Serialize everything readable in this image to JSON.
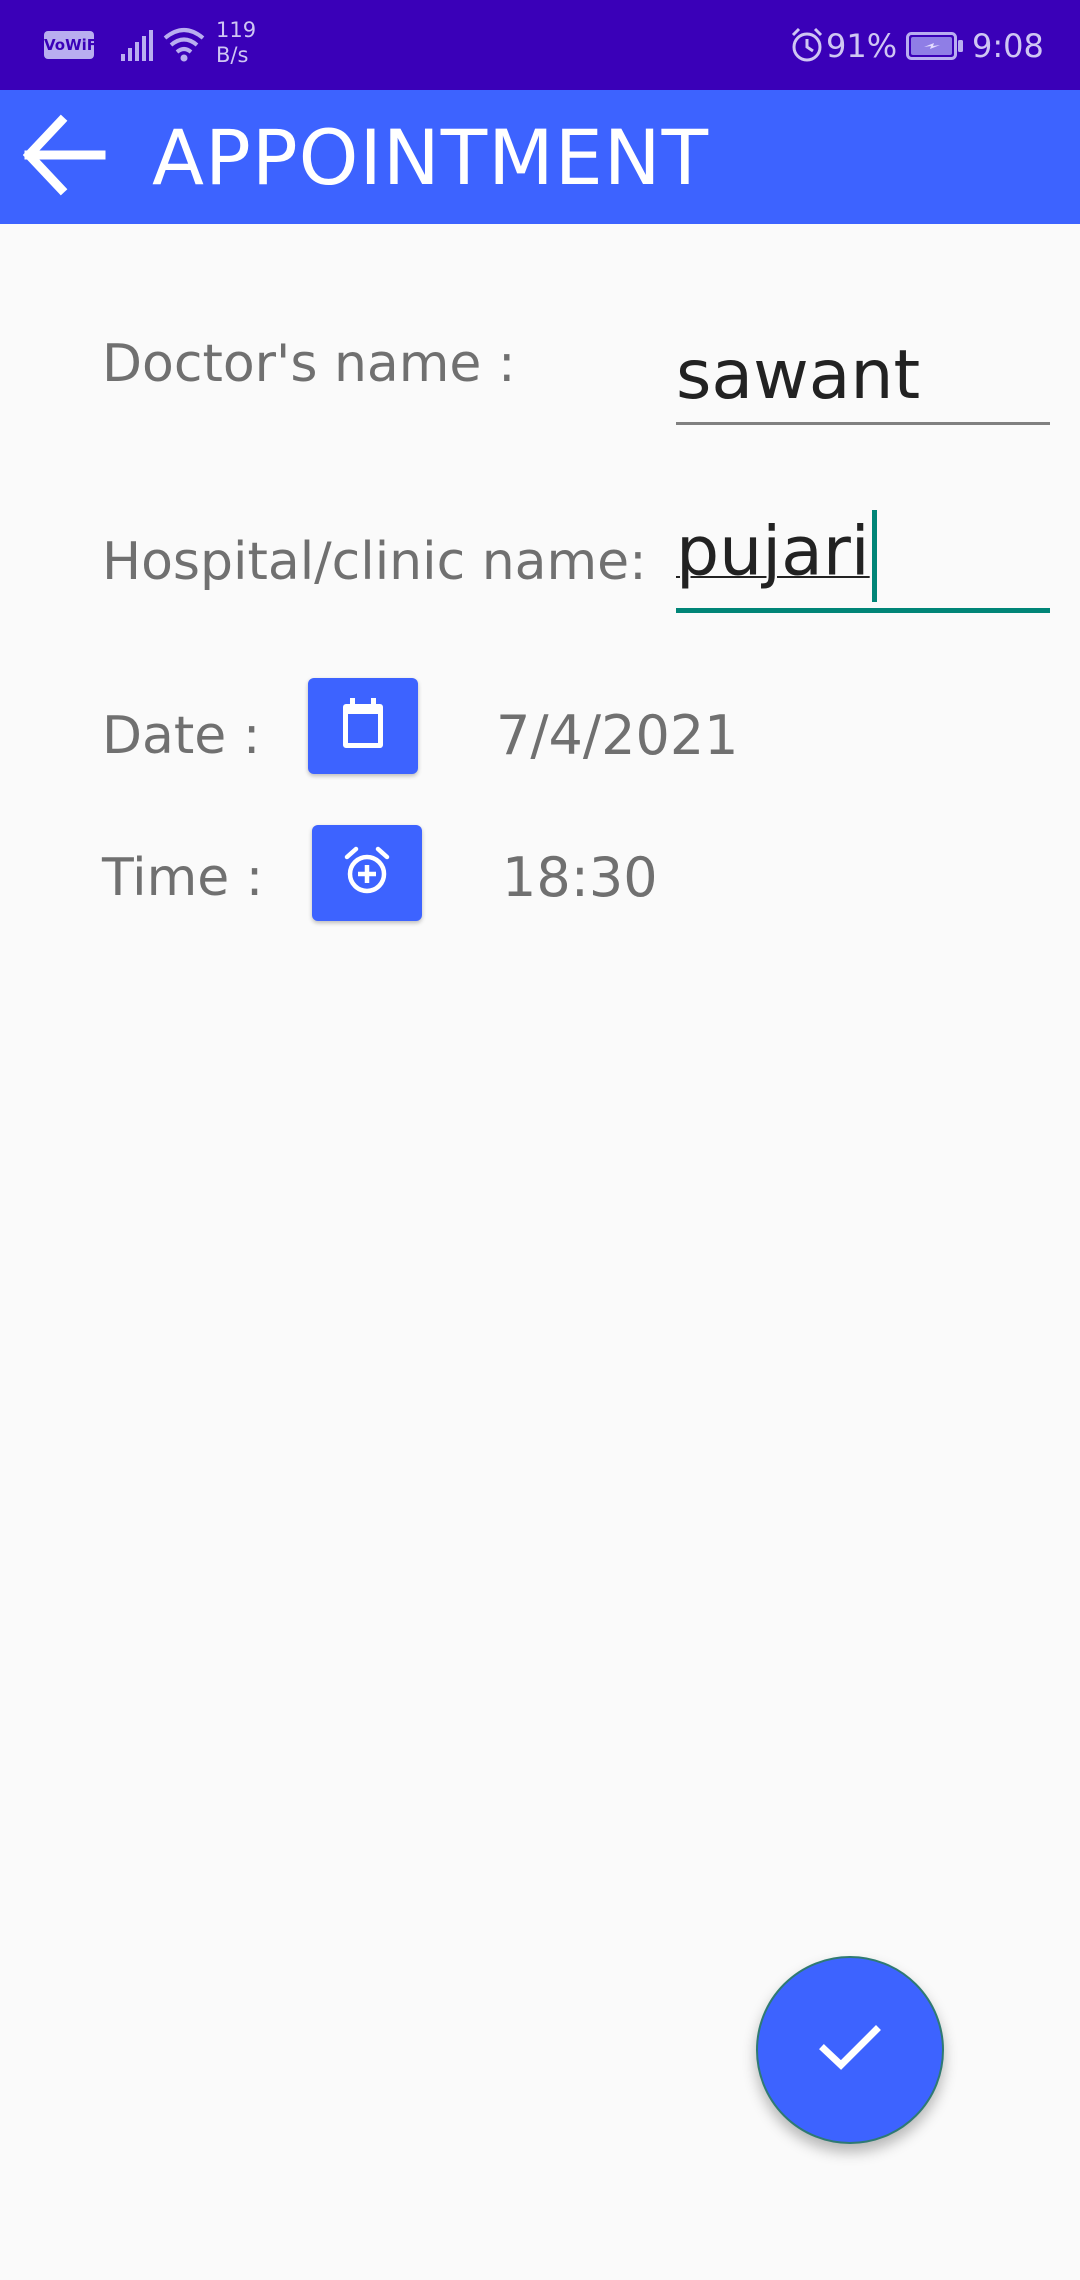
{
  "status_bar": {
    "vowifi_label": "VoWiFi",
    "net_speed_value": "119",
    "net_speed_unit": "B/s",
    "battery_percent": "91%",
    "clock": "9:08",
    "icons": [
      "signal-icon",
      "wifi-icon",
      "alarm-icon",
      "battery-charging-icon"
    ]
  },
  "app_bar": {
    "title": "APPOINTMENT",
    "back_icon": "arrow-left-icon",
    "color": "#3d63ff"
  },
  "form": {
    "doctor_label": "Doctor's name :",
    "doctor_value": "sawant",
    "hospital_label": "Hospital/clinic name:",
    "hospital_value": "pujari",
    "date_label": "Date :",
    "date_icon": "calendar-icon",
    "date_value": "7/4/2021",
    "time_label": "Time :",
    "time_icon": "alarm-add-icon",
    "time_value": "18:30"
  },
  "fab": {
    "icon": "check-icon"
  },
  "colors": {
    "status_bar": "#3a00b8",
    "accent": "#3d63ff",
    "focus_underline": "#008577",
    "background": "#fafafa"
  }
}
